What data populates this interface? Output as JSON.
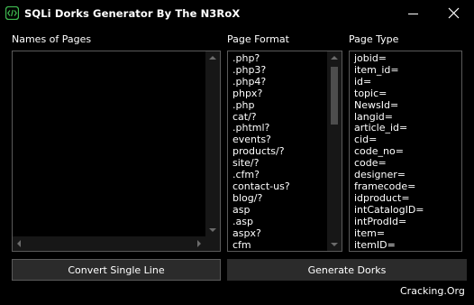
{
  "window": {
    "title": "SQLi Dorks Generator By The N3RoX",
    "app_icon": "code-brackets-icon",
    "minimize_icon": "minimize-icon",
    "close_icon": "close-icon"
  },
  "labels": {
    "names_of_pages": "Names of Pages",
    "page_format": "Page Format",
    "page_type": "Page Type"
  },
  "names_of_pages": {
    "value": ""
  },
  "page_format": {
    "items": [
      ".php?",
      ".php3?",
      ".php4?",
      "phpx?",
      ".php",
      "cat/?",
      ".phtml?",
      "events?",
      "products/?",
      "site/?",
      ".cfm?",
      "contact-us?",
      "blog/?",
      "asp",
      ".asp",
      "aspx?",
      "cfm"
    ]
  },
  "page_type": {
    "items": [
      "jobid=",
      "item_id=",
      "id=",
      "topic=",
      "NewsId=",
      "langid=",
      "article_id=",
      "cid=",
      "code_no=",
      "code=",
      "designer=",
      "framecode=",
      "idproduct=",
      "intCatalogID=",
      "intProdId=",
      "item=",
      "itemID="
    ]
  },
  "buttons": {
    "convert": "Convert Single Line",
    "generate": "Generate Dorks"
  },
  "footer": {
    "credit": "Cracking.Org"
  },
  "colors": {
    "background": "#000000",
    "text": "#ffffff",
    "button_bg": "#2b2b2b",
    "border": "#5a5a5a",
    "icon_green": "#3fb950"
  }
}
